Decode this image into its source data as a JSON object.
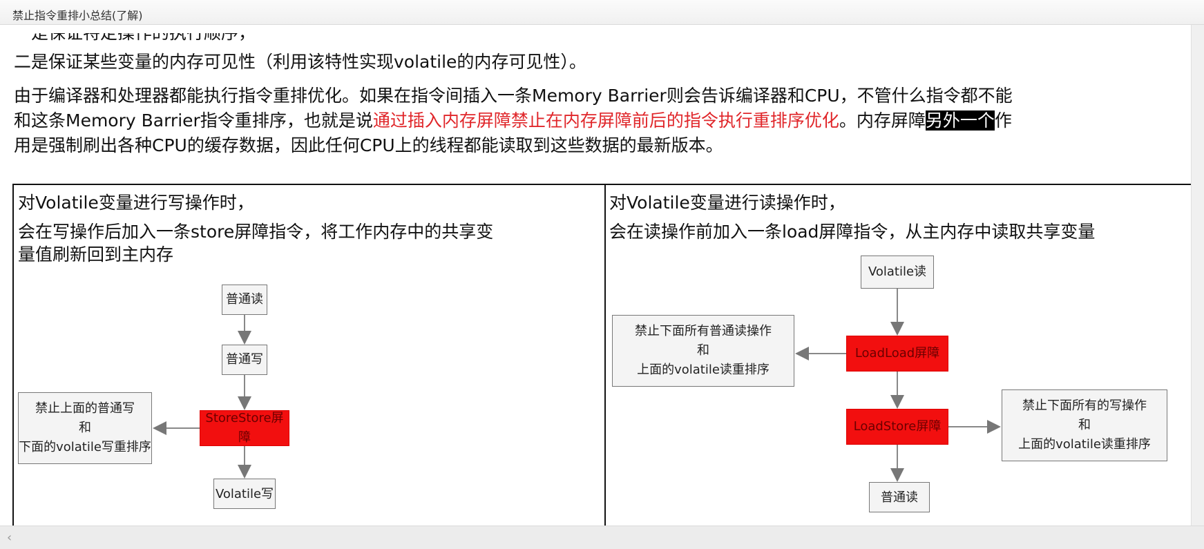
{
  "window": {
    "title": "禁止指令重排小总结(了解)"
  },
  "doc": {
    "line_cut": "一是保证特定操作的执行顺序，",
    "line2": "二是保证某些变量的内存可见性（利用该特性实现volatile的内存可见性）。",
    "para3": {
      "line1": "由于编译器和处理器都能执行指令重排优化。如果在指令间插入一条Memory Barrier则会告诉编译器和CPU，不管什么指令都不能",
      "line2_a": "和这条Memory Barrier指令重排序，也就是说",
      "line2_red": "通过插入内存屏障禁止在内存屏障前后的指令执行重排序优化",
      "line2_b": "。内存屏障",
      "line2_hl": "另外一个",
      "line2_c": "作",
      "line3": "用是强制刷出各种CPU的缓存数据，因此任何CPU上的线程都能读取到这些数据的最新版本。"
    },
    "left_cell": {
      "heading": "对Volatile变量进行写操作时，",
      "desc_line1": "会在写操作后加入一条store屏障指令，将工作内存中的共享变",
      "desc_line2": "量值刷新回到主内存",
      "nodes": {
        "normal_read": "普通读",
        "normal_write": "普通写",
        "storestore": "StoreStore屏障",
        "volatile_write": "Volatile写",
        "note_line1": "禁止上面的普通写",
        "note_line2": "和",
        "note_line3": "下面的volatile写重排序"
      }
    },
    "right_cell": {
      "heading": "对Volatile变量进行读操作时，",
      "desc_line1": "会在读操作前加入一条load屏障指令，从主内存中读取共享变量",
      "nodes": {
        "volatile_read": "Volatile读",
        "loadload": "LoadLoad屏障",
        "loadstore": "LoadStore屏障",
        "normal_read": "普通读",
        "note1_line1": "禁止下面所有普通读操作",
        "note1_line2": "和",
        "note1_line3": "上面的volatile读重排序",
        "note2_line1": "禁止下面所有的写操作",
        "note2_line2": "和",
        "note2_line3": "上面的volatile读重排序"
      }
    }
  },
  "colors": {
    "highlight_text": "#e0262a",
    "barrier_fill": "#f20f0f"
  }
}
